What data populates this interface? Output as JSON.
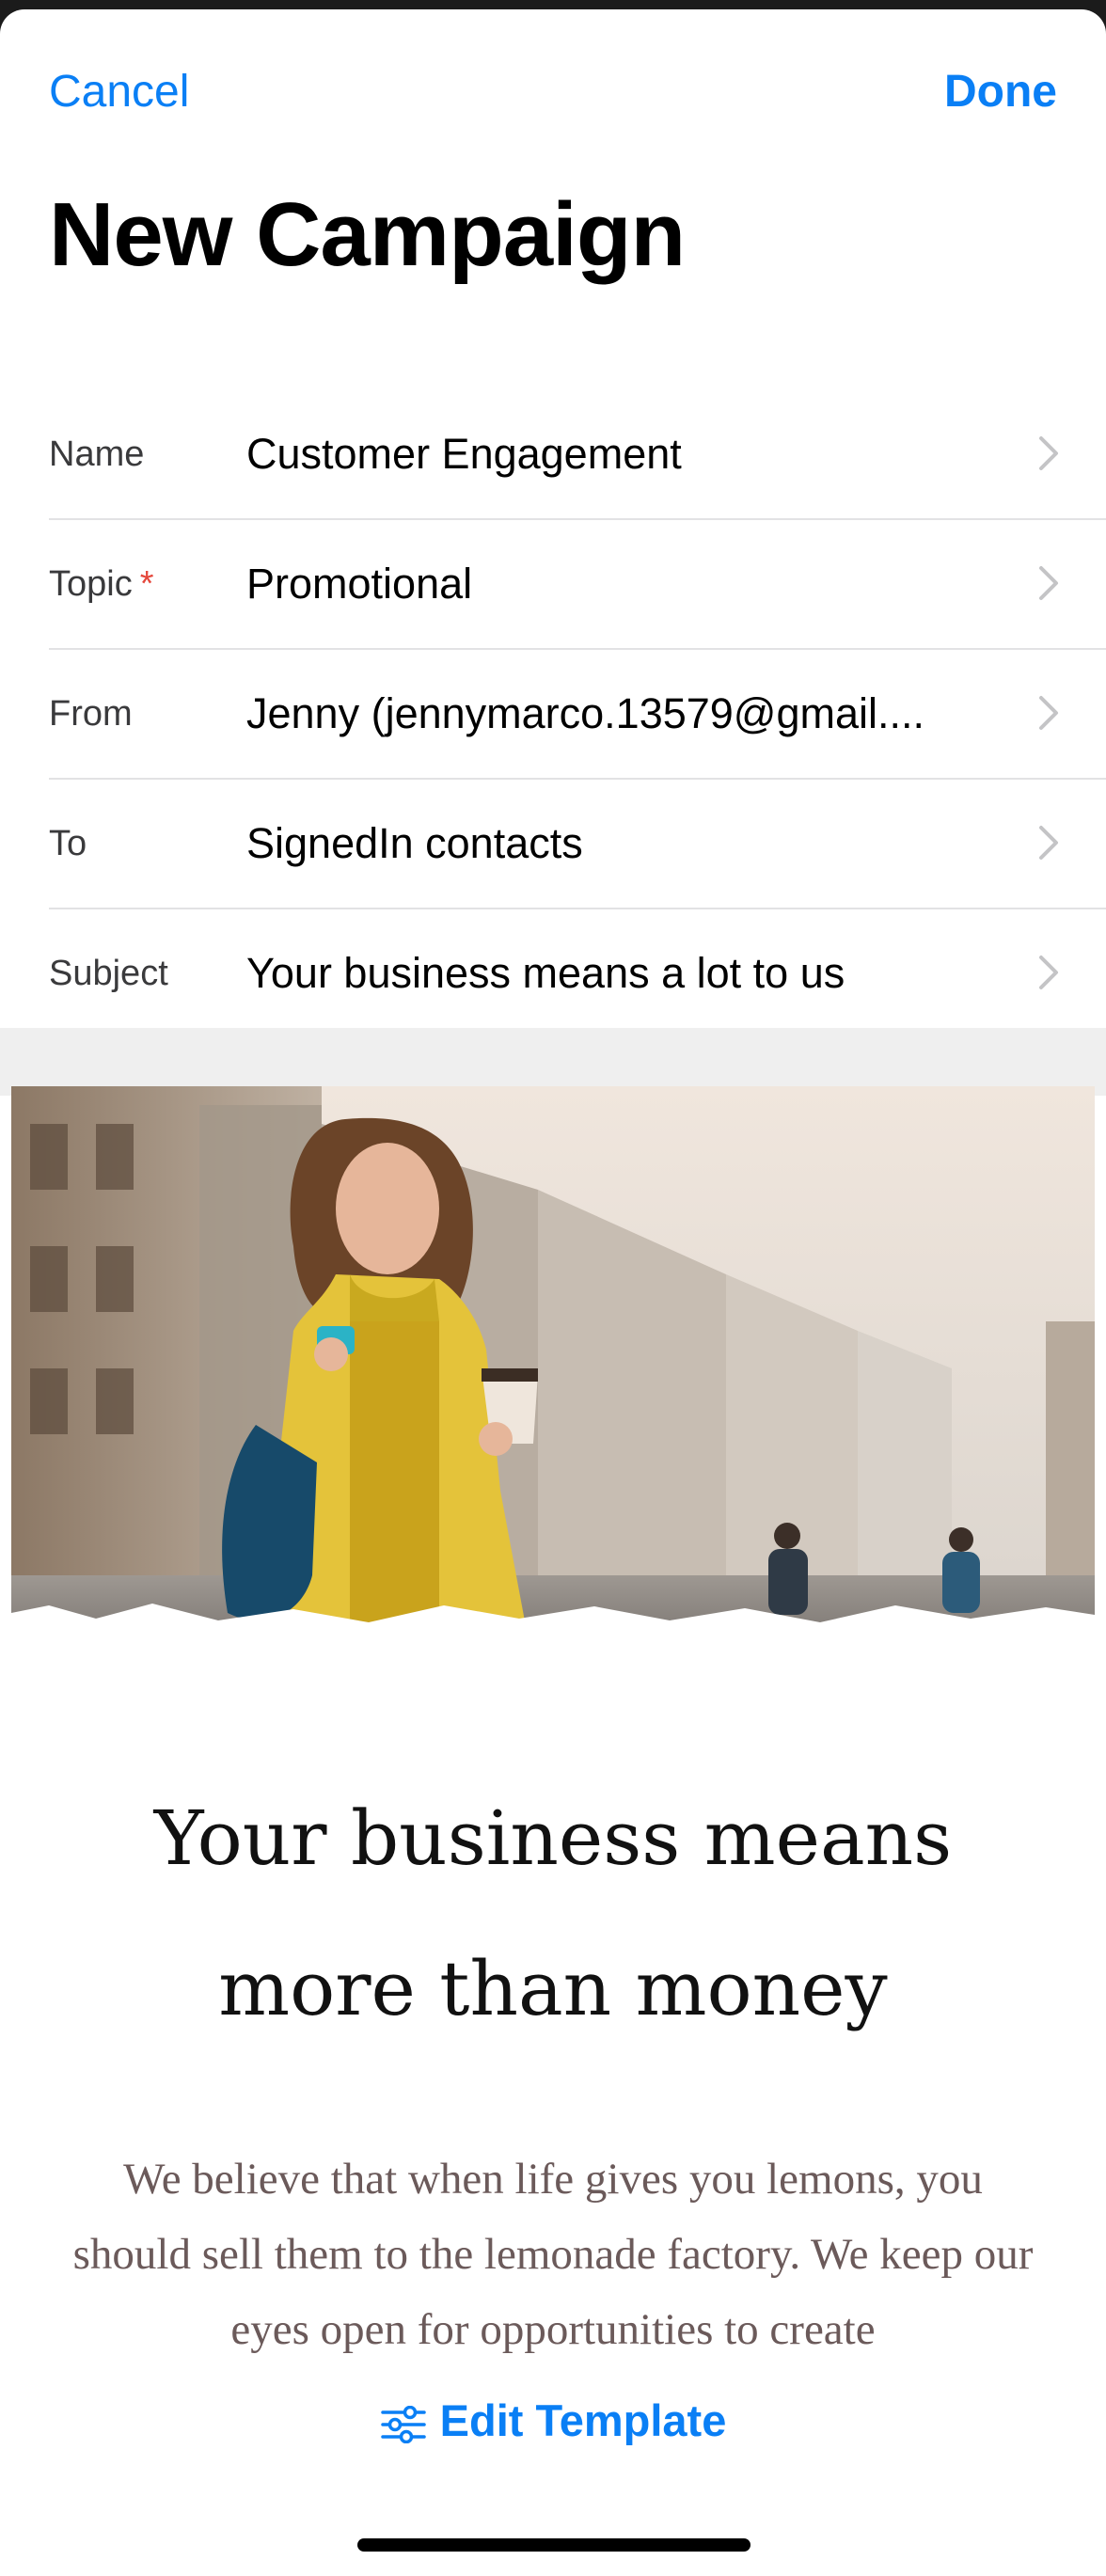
{
  "header": {
    "cancel_label": "Cancel",
    "done_label": "Done",
    "title": "New Campaign"
  },
  "form": {
    "rows": [
      {
        "label": "Name",
        "value": "Customer Engagement",
        "required": false
      },
      {
        "label": "Topic",
        "value": "Promotional",
        "required": true,
        "required_marker": "*"
      },
      {
        "label": "From",
        "value": "Jenny (jennymarco.13579@gmail....",
        "required": false
      },
      {
        "label": "To",
        "value": "SignedIn contacts",
        "required": false
      },
      {
        "label": "Subject",
        "value": "Your business means a lot to us",
        "required": false
      }
    ]
  },
  "preview": {
    "headline_line1": "Your business means",
    "headline_line2": "more than money",
    "body": "We believe that when life gives you lemons, you should sell them to the lemonade factory. We keep our eyes open for opportunities to create"
  },
  "footer": {
    "edit_template_label": "Edit Template"
  },
  "colors": {
    "accent": "#0a7ff5",
    "required": "#e5483c",
    "body_text": "#6b5a5a"
  },
  "icons": {
    "row_chevron": "chevron-right-icon",
    "edit_template": "sliders-icon"
  }
}
